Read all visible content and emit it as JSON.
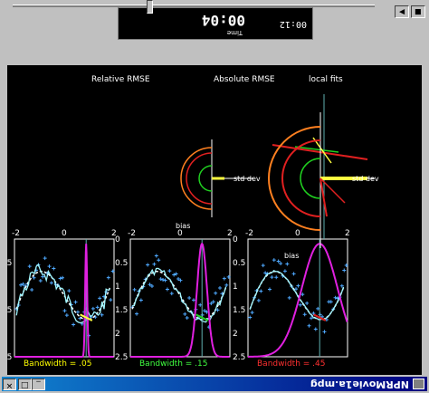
{
  "window": {
    "title": "NPRMovie1a.mpg",
    "buttons": {
      "minimize": "_",
      "maximize": "□",
      "close": "✕"
    }
  },
  "player": {
    "time_label": "Time",
    "time_current": "00:04",
    "time_total": "00:12",
    "progress": 0.38,
    "play_glyph": "▶",
    "stop_glyph": "■"
  },
  "plots": {
    "top_titles": [
      "local fits",
      "Absolute RMSE",
      "Relative RMSE"
    ],
    "std_dev_label": "std dev",
    "bias_label": "bias",
    "bottom_panels": [
      {
        "caption": "Bandwidth = .05",
        "caption_color": "#ffff00"
      },
      {
        "caption": "Bandwidth = .15",
        "caption_color": "#40ff40"
      },
      {
        "caption": "Bandwidth = .45",
        "caption_color": "#ff3030"
      }
    ],
    "x_ticks": [
      "-2",
      "0",
      "2"
    ],
    "y_ticks": [
      "0",
      "0.5",
      "1",
      "1.5",
      "2",
      "2.5"
    ],
    "colors": {
      "points": "#4fa9ff",
      "fit": "#9ff5ff",
      "truth": "#ffffff",
      "kernel": "#e020e0",
      "axis": "#5fb0b0",
      "orange": "#ff8020",
      "green": "#20d020",
      "red": "#e02020",
      "yellow": "#ffff40"
    }
  }
}
